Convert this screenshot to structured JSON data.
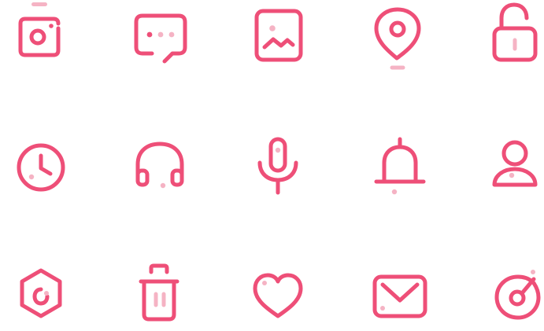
{
  "colors": {
    "accent": "#ee4f78",
    "accent_soft": "#f5b3c4"
  },
  "icon_grid": {
    "rows": [
      [
        "camera-icon",
        "chat-bubble-icon",
        "image-icon",
        "location-pin-icon",
        "unlocked-padlock-icon"
      ],
      [
        "clock-icon",
        "headphones-icon",
        "microphone-icon",
        "bell-icon",
        "user-icon"
      ],
      [
        "hexagon-settings-icon",
        "trash-icon",
        "heart-icon",
        "mail-icon",
        "disc-icon"
      ]
    ]
  }
}
